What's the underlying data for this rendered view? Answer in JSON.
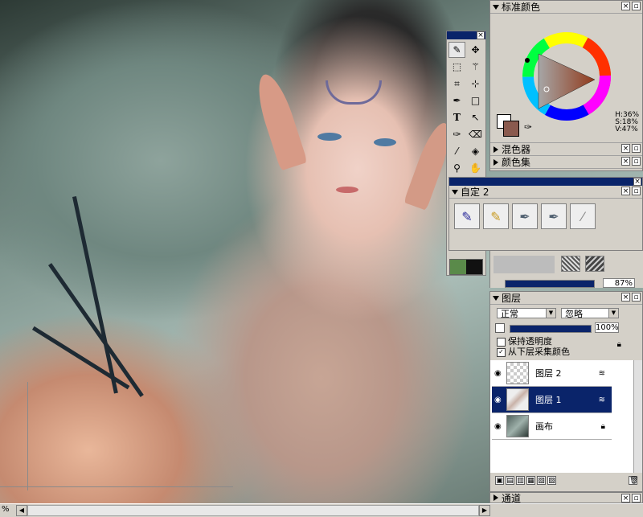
{
  "canvas": {
    "zoom_label": "%"
  },
  "toolbox": {
    "tools": [
      "brush-icon",
      "move-icon",
      "rect-select-icon",
      "magic-wand-icon",
      "crop-icon",
      "transform-icon",
      "pen-icon",
      "shape-icon",
      "text-icon",
      "arrow-icon",
      "dropper-icon",
      "eraser-icon",
      "picker-icon",
      "bucket-icon",
      "zoom-icon",
      "hand-icon"
    ]
  },
  "color_panel": {
    "title": "标准颜色",
    "hsv": {
      "h": "H:36%",
      "s": "S:18%",
      "v": "V:47%"
    },
    "mixer_label": "混色器",
    "swatches_label": "颜色集",
    "current_color": "#8a5a4e"
  },
  "custom_panel": {
    "title": "自定 2"
  },
  "opacity_value": "87%",
  "layers_panel": {
    "title": "图层",
    "blend_mode": "正常",
    "composite": "忽略",
    "opacity": "100%",
    "preserve_transparency": "保持透明度",
    "pick_underlying": "从下层采集颜色",
    "layers": [
      {
        "name": "图层 2",
        "selected": false
      },
      {
        "name": "图层 1",
        "selected": true
      },
      {
        "name": "画布",
        "selected": false
      }
    ]
  },
  "channels_panel": {
    "title": "通道"
  }
}
